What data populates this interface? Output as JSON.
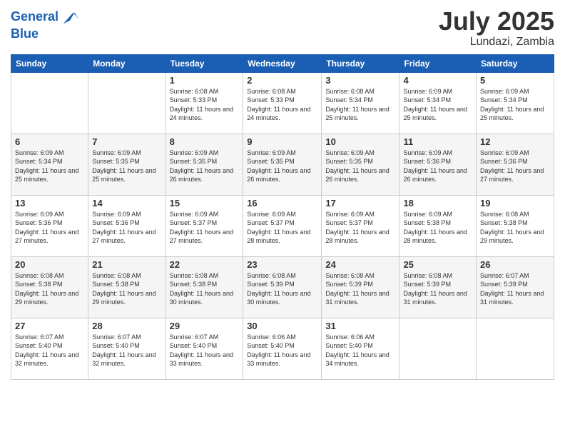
{
  "header": {
    "logo_line1": "General",
    "logo_line2": "Blue",
    "title": "July 2025",
    "subtitle": "Lundazi, Zambia"
  },
  "days_of_week": [
    "Sunday",
    "Monday",
    "Tuesday",
    "Wednesday",
    "Thursday",
    "Friday",
    "Saturday"
  ],
  "weeks": [
    [
      {
        "day": "",
        "sunrise": "",
        "sunset": "",
        "daylight": ""
      },
      {
        "day": "",
        "sunrise": "",
        "sunset": "",
        "daylight": ""
      },
      {
        "day": "1",
        "sunrise": "Sunrise: 6:08 AM",
        "sunset": "Sunset: 5:33 PM",
        "daylight": "Daylight: 11 hours and 24 minutes."
      },
      {
        "day": "2",
        "sunrise": "Sunrise: 6:08 AM",
        "sunset": "Sunset: 5:33 PM",
        "daylight": "Daylight: 11 hours and 24 minutes."
      },
      {
        "day": "3",
        "sunrise": "Sunrise: 6:08 AM",
        "sunset": "Sunset: 5:34 PM",
        "daylight": "Daylight: 11 hours and 25 minutes."
      },
      {
        "day": "4",
        "sunrise": "Sunrise: 6:09 AM",
        "sunset": "Sunset: 5:34 PM",
        "daylight": "Daylight: 11 hours and 25 minutes."
      },
      {
        "day": "5",
        "sunrise": "Sunrise: 6:09 AM",
        "sunset": "Sunset: 5:34 PM",
        "daylight": "Daylight: 11 hours and 25 minutes."
      }
    ],
    [
      {
        "day": "6",
        "sunrise": "Sunrise: 6:09 AM",
        "sunset": "Sunset: 5:34 PM",
        "daylight": "Daylight: 11 hours and 25 minutes."
      },
      {
        "day": "7",
        "sunrise": "Sunrise: 6:09 AM",
        "sunset": "Sunset: 5:35 PM",
        "daylight": "Daylight: 11 hours and 25 minutes."
      },
      {
        "day": "8",
        "sunrise": "Sunrise: 6:09 AM",
        "sunset": "Sunset: 5:35 PM",
        "daylight": "Daylight: 11 hours and 26 minutes."
      },
      {
        "day": "9",
        "sunrise": "Sunrise: 6:09 AM",
        "sunset": "Sunset: 5:35 PM",
        "daylight": "Daylight: 11 hours and 26 minutes."
      },
      {
        "day": "10",
        "sunrise": "Sunrise: 6:09 AM",
        "sunset": "Sunset: 5:35 PM",
        "daylight": "Daylight: 11 hours and 26 minutes."
      },
      {
        "day": "11",
        "sunrise": "Sunrise: 6:09 AM",
        "sunset": "Sunset: 5:36 PM",
        "daylight": "Daylight: 11 hours and 26 minutes."
      },
      {
        "day": "12",
        "sunrise": "Sunrise: 6:09 AM",
        "sunset": "Sunset: 5:36 PM",
        "daylight": "Daylight: 11 hours and 27 minutes."
      }
    ],
    [
      {
        "day": "13",
        "sunrise": "Sunrise: 6:09 AM",
        "sunset": "Sunset: 5:36 PM",
        "daylight": "Daylight: 11 hours and 27 minutes."
      },
      {
        "day": "14",
        "sunrise": "Sunrise: 6:09 AM",
        "sunset": "Sunset: 5:36 PM",
        "daylight": "Daylight: 11 hours and 27 minutes."
      },
      {
        "day": "15",
        "sunrise": "Sunrise: 6:09 AM",
        "sunset": "Sunset: 5:37 PM",
        "daylight": "Daylight: 11 hours and 27 minutes."
      },
      {
        "day": "16",
        "sunrise": "Sunrise: 6:09 AM",
        "sunset": "Sunset: 5:37 PM",
        "daylight": "Daylight: 11 hours and 28 minutes."
      },
      {
        "day": "17",
        "sunrise": "Sunrise: 6:09 AM",
        "sunset": "Sunset: 5:37 PM",
        "daylight": "Daylight: 11 hours and 28 minutes."
      },
      {
        "day": "18",
        "sunrise": "Sunrise: 6:09 AM",
        "sunset": "Sunset: 5:38 PM",
        "daylight": "Daylight: 11 hours and 28 minutes."
      },
      {
        "day": "19",
        "sunrise": "Sunrise: 6:08 AM",
        "sunset": "Sunset: 5:38 PM",
        "daylight": "Daylight: 11 hours and 29 minutes."
      }
    ],
    [
      {
        "day": "20",
        "sunrise": "Sunrise: 6:08 AM",
        "sunset": "Sunset: 5:38 PM",
        "daylight": "Daylight: 11 hours and 29 minutes."
      },
      {
        "day": "21",
        "sunrise": "Sunrise: 6:08 AM",
        "sunset": "Sunset: 5:38 PM",
        "daylight": "Daylight: 11 hours and 29 minutes."
      },
      {
        "day": "22",
        "sunrise": "Sunrise: 6:08 AM",
        "sunset": "Sunset: 5:38 PM",
        "daylight": "Daylight: 11 hours and 30 minutes."
      },
      {
        "day": "23",
        "sunrise": "Sunrise: 6:08 AM",
        "sunset": "Sunset: 5:39 PM",
        "daylight": "Daylight: 11 hours and 30 minutes."
      },
      {
        "day": "24",
        "sunrise": "Sunrise: 6:08 AM",
        "sunset": "Sunset: 5:39 PM",
        "daylight": "Daylight: 11 hours and 31 minutes."
      },
      {
        "day": "25",
        "sunrise": "Sunrise: 6:08 AM",
        "sunset": "Sunset: 5:39 PM",
        "daylight": "Daylight: 11 hours and 31 minutes."
      },
      {
        "day": "26",
        "sunrise": "Sunrise: 6:07 AM",
        "sunset": "Sunset: 5:39 PM",
        "daylight": "Daylight: 11 hours and 31 minutes."
      }
    ],
    [
      {
        "day": "27",
        "sunrise": "Sunrise: 6:07 AM",
        "sunset": "Sunset: 5:40 PM",
        "daylight": "Daylight: 11 hours and 32 minutes."
      },
      {
        "day": "28",
        "sunrise": "Sunrise: 6:07 AM",
        "sunset": "Sunset: 5:40 PM",
        "daylight": "Daylight: 11 hours and 32 minutes."
      },
      {
        "day": "29",
        "sunrise": "Sunrise: 6:07 AM",
        "sunset": "Sunset: 5:40 PM",
        "daylight": "Daylight: 11 hours and 33 minutes."
      },
      {
        "day": "30",
        "sunrise": "Sunrise: 6:06 AM",
        "sunset": "Sunset: 5:40 PM",
        "daylight": "Daylight: 11 hours and 33 minutes."
      },
      {
        "day": "31",
        "sunrise": "Sunrise: 6:06 AM",
        "sunset": "Sunset: 5:40 PM",
        "daylight": "Daylight: 11 hours and 34 minutes."
      },
      {
        "day": "",
        "sunrise": "",
        "sunset": "",
        "daylight": ""
      },
      {
        "day": "",
        "sunrise": "",
        "sunset": "",
        "daylight": ""
      }
    ]
  ]
}
